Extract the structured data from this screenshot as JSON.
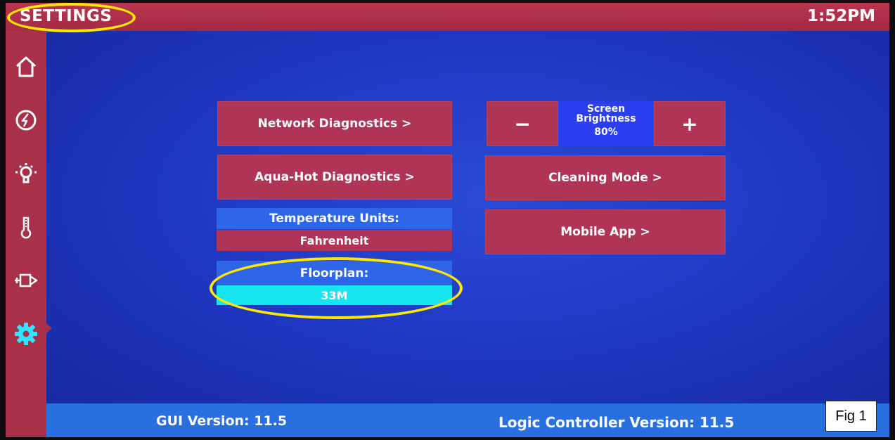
{
  "header": {
    "title": "SETTINGS",
    "time": "1:52PM"
  },
  "sidebar": {
    "items": [
      {
        "icon": "home-icon"
      },
      {
        "icon": "power-icon"
      },
      {
        "icon": "light-bulb-icon"
      },
      {
        "icon": "thermometer-icon"
      },
      {
        "icon": "slide-out-icon"
      },
      {
        "icon": "gear-icon",
        "active": true
      }
    ]
  },
  "buttons": {
    "network_diagnostics": "Network Diagnostics >",
    "aquahot_diagnostics": "Aqua-Hot Diagnostics >",
    "cleaning_mode": "Cleaning Mode >",
    "mobile_app": "Mobile App >"
  },
  "brightness": {
    "line1": "Screen",
    "line2": "Brightness",
    "value": "80%",
    "minus_label": "−",
    "plus_label": "+"
  },
  "temperature_units": {
    "label": "Temperature Units:",
    "value": "Fahrenheit"
  },
  "floorplan": {
    "label": "Floorplan:",
    "value": "33M"
  },
  "footer": {
    "gui_version": "GUI Version:  11.5",
    "logic_version": "Logic Controller Version:  11.5"
  },
  "figure_label": "Fig 1",
  "colors": {
    "accent_red": "#b03455",
    "background_blue": "#1f38c2",
    "label_blue": "#2f66e8",
    "selected_cyan": "#17e6f0",
    "highlight_yellow": "#ffe800"
  }
}
